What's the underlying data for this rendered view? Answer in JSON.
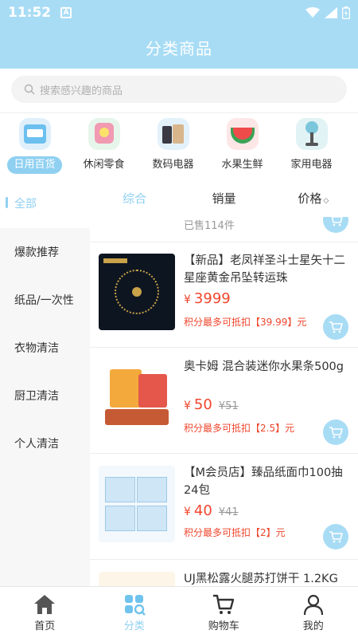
{
  "status": {
    "time": "11:52",
    "notif_icon": "A"
  },
  "header": {
    "title": "分类商品"
  },
  "search": {
    "placeholder": "搜索感兴趣的商品"
  },
  "categories": [
    {
      "label": "日用百货",
      "icon": "daily-goods-icon",
      "active": true
    },
    {
      "label": "休闲零食",
      "icon": "snack-icon",
      "active": false
    },
    {
      "label": "数码电器",
      "icon": "digital-icon",
      "active": false
    },
    {
      "label": "水果生鲜",
      "icon": "fruit-icon",
      "active": false
    },
    {
      "label": "家用电器",
      "icon": "appliance-icon",
      "active": false
    }
  ],
  "sidebar": {
    "items": [
      {
        "label": "全部",
        "active": true
      },
      {
        "label": "爆款推荐",
        "active": false
      },
      {
        "label": "纸品/一次性",
        "active": false
      },
      {
        "label": "衣物清洁",
        "active": false
      },
      {
        "label": "厨卫清洁",
        "active": false
      },
      {
        "label": "个人清洁",
        "active": false
      }
    ]
  },
  "sorts": [
    {
      "label": "综合",
      "active": true
    },
    {
      "label": "销量",
      "active": false
    },
    {
      "label": "价格",
      "active": false,
      "arrows": "◇"
    }
  ],
  "products": [
    {
      "sold": "已售114件"
    },
    {
      "name": "【新品】老凤祥圣斗士星矢十二星座黄金吊坠转运珠",
      "yen": "¥",
      "price": "3999",
      "old_price": "",
      "points": "积分最多可抵扣【39.99】元"
    },
    {
      "name": "奥卡姆 混合装迷你水果条500g",
      "yen": "¥",
      "price": "50",
      "old_price": "¥51",
      "points": "积分最多可抵扣【2.5】元"
    },
    {
      "name": "【M会员店】臻品纸面巾100抽24包",
      "yen": "¥",
      "price": "40",
      "old_price": "¥41",
      "points": "积分最多可抵扣【2】元"
    },
    {
      "name": "UJ黑松露火腿苏打饼干 1.2KG"
    }
  ],
  "tabbar": [
    {
      "label": "首页",
      "icon": "home-icon",
      "active": false
    },
    {
      "label": "分类",
      "icon": "category-icon",
      "active": true
    },
    {
      "label": "购物车",
      "icon": "cart-icon",
      "active": false
    },
    {
      "label": "我的",
      "icon": "user-icon",
      "active": false
    }
  ],
  "colors": {
    "accent": "#8fd0f1",
    "header": "#a8dcf5",
    "price": "#f0462d"
  }
}
